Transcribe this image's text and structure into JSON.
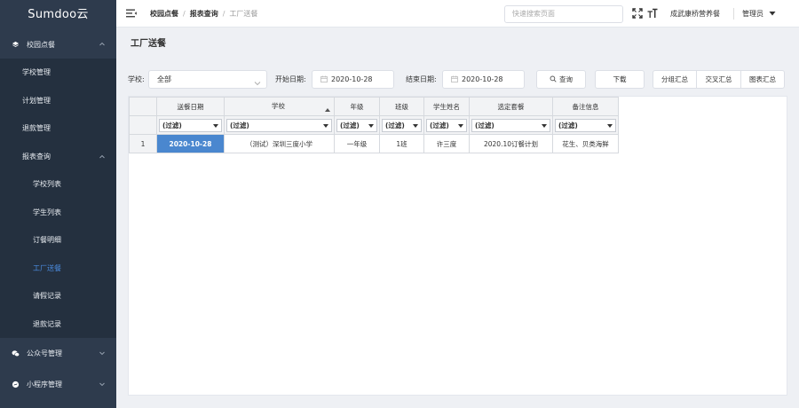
{
  "app": {
    "brand": "Sumdoo云"
  },
  "sidebar": {
    "groups": [
      {
        "label": "校园点餐",
        "icon": "layers-icon"
      },
      {
        "label": "公众号管理",
        "icon": "wechat-icon"
      },
      {
        "label": "小程序管理",
        "icon": "miniprogram-icon"
      }
    ],
    "items": [
      {
        "label": "学校管理"
      },
      {
        "label": "计划管理"
      },
      {
        "label": "退款管理"
      },
      {
        "label": "报表查询"
      }
    ],
    "report_items": [
      {
        "label": "学校列表"
      },
      {
        "label": "学生列表"
      },
      {
        "label": "订餐明细"
      },
      {
        "label": "工厂送餐"
      },
      {
        "label": "请假记录"
      },
      {
        "label": "退款记录"
      }
    ],
    "active_color": "#4b8ce0"
  },
  "topbar": {
    "breadcrumb": [
      "校园点餐",
      "报表查询",
      "工厂送餐"
    ],
    "search_placeholder": "快速搜索页面",
    "org_name": "成武康桥营养餐",
    "user": "管理员"
  },
  "page": {
    "title": "工厂送餐"
  },
  "filters": {
    "school_label": "学校:",
    "school_value": "全部",
    "start_label": "开始日期:",
    "start_value": "2020-10-28",
    "end_label": "结束日期:",
    "end_value": "2020-10-28",
    "query_btn": "查询",
    "download_btn": "下载",
    "group_btn": "分组汇总",
    "cross_btn": "交叉汇总",
    "chart_btn": "图表汇总"
  },
  "grid": {
    "columns": [
      "送餐日期",
      "学校",
      "年级",
      "班级",
      "学生姓名",
      "选定套餐",
      "备注信息"
    ],
    "filter_text": "(过滤)",
    "rows": [
      {
        "num": "1",
        "cells": [
          "2020-10-28",
          "（测试）深圳三度小学",
          "一年级",
          "1班",
          "许三度",
          "2020.10订餐计划",
          "花生、贝类海鲜"
        ]
      }
    ],
    "selected_color": "#4a87cf"
  }
}
